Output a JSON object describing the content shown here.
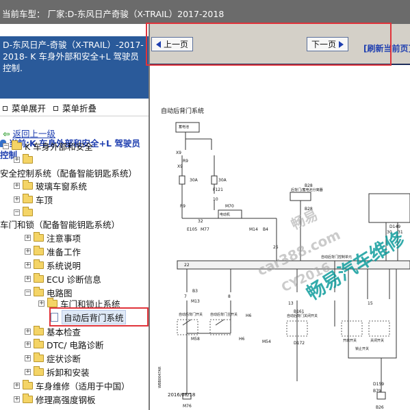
{
  "topbar": {
    "title": "当前车型： 厂家:D-东风日产奇骏（X-TRAIL）2017-2018"
  },
  "sidebar": {
    "header": "D-东风日产-奇骏（X-TRAIL）-2017-2018- K 车身外部和安全+L 驾驶员控制.",
    "expand_label": "菜单展开",
    "collapse_label": "菜单折叠",
    "back_label": "返回上一级",
    "current": "当前:K 车身外部和安全+L 驾驶员控制",
    "tree": [
      {
        "label": "K 车身外部和安全"
      },
      {
        "label": ""
      },
      {
        "label": "安全控制系统（配备智能钥匙系统）"
      },
      {
        "label": "玻璃车窗系统"
      },
      {
        "label": "车顶"
      },
      {
        "label": ""
      },
      {
        "label": "车门和锁（配备智能钥匙系统）"
      },
      {
        "label": "注意事项"
      },
      {
        "label": "准备工作"
      },
      {
        "label": "系统说明"
      },
      {
        "label": "ECU 诊断信息"
      },
      {
        "label": "电路图"
      },
      {
        "label": "车门和锁止系统"
      },
      {
        "label": "自动后背门系统"
      },
      {
        "label": "基本检查"
      },
      {
        "label": "DTC/ 电路诊断"
      },
      {
        "label": "症状诊断"
      },
      {
        "label": "拆卸和安装"
      },
      {
        "label": "车身维修（适用于中国）"
      },
      {
        "label": "修理高强度钢板"
      }
    ]
  },
  "content": {
    "prev_label": "上一页",
    "next_label": "下一页",
    "refresh_label": "[刷新当前页]",
    "diagram": {
      "title": "自动后背门系统",
      "battery": "蓄电池",
      "labels": {
        "x9a": "X9",
        "x9b": "X9",
        "r9a": "R9",
        "r9b": "R9",
        "f30": "30A",
        "f30b": "30A",
        "f121": "F121",
        "n10": "10",
        "b28a": "B28",
        "b28b": "B28",
        "m70": "M70",
        "e105": "E105",
        "m77": "M77",
        "m14": "M14",
        "b4": "B4",
        "n32": "32",
        "n25": "25",
        "n22": "22",
        "n7": "7",
        "n8": "8",
        "b3": "B3",
        "m13": "M13",
        "n13": "13",
        "b161": "B161",
        "b150": "B150",
        "n15": "15",
        "n30": "30",
        "n31": "31",
        "d149": "D149",
        "h6a": "H6",
        "h6b": "H6",
        "m58": "M58",
        "m54": "M54",
        "d172": "D172",
        "m76": "M76",
        "d159": "D159",
        "b79": "B79",
        "b26": "B26"
      },
      "small": {
        "motor": "电动机",
        "cm": "自动后背门控制单元",
        "sw1": "自动后背门开关",
        "sw2": "自动后背门主开关",
        "sw3": "自动后背门关闭开关",
        "sw4": "开启开关",
        "sw5": "关闭开关",
        "sw6": "锁止开关",
        "fuse": "后背门/蓄电池分离器"
      },
      "date": "2016/08/18",
      "code": "WBB0047AR"
    },
    "watermarks": {
      "w1": "畅易",
      "w2": "car388.com",
      "w3": "CY2016",
      "w4": "畅易汽车维修"
    }
  }
}
